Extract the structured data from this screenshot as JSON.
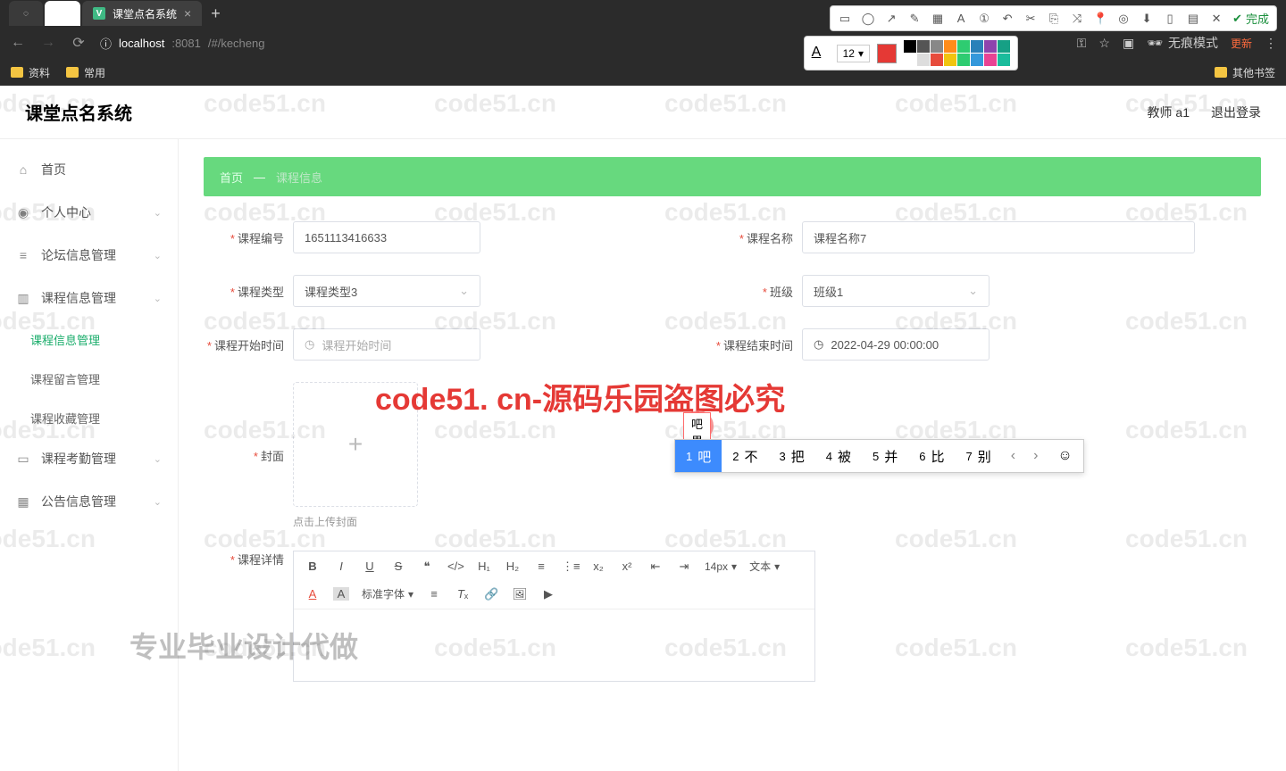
{
  "browser": {
    "tab_blank": "",
    "tab_title": "课堂点名系统",
    "url_host": "localhost",
    "url_port": ":8081",
    "url_path": "/#/kecheng",
    "bookmarks": [
      "资料",
      "常用"
    ],
    "other_bookmarks": "其他书签",
    "incognito": "无痕模式",
    "update": "更新"
  },
  "screenshot_tool": {
    "font_size": "12",
    "done": "完成",
    "colors_row1": [
      "#000000",
      "#555555",
      "#888888",
      "#ff8c1a",
      "#2ecc71",
      "#2980b9",
      "#8e44ad",
      "#16a085"
    ],
    "colors_row2": [
      "#ffffff",
      "#dddddd",
      "#e74c3c",
      "#f1c40f",
      "#2ecc71",
      "#3498db",
      "#e84393",
      "#1abc9c"
    ]
  },
  "header": {
    "app_title": "课堂点名系统",
    "user": "教师 a1",
    "logout": "退出登录"
  },
  "sidebar": {
    "home": "首页",
    "items": [
      {
        "label": "个人中心",
        "icon": "user"
      },
      {
        "label": "论坛信息管理",
        "icon": "list"
      },
      {
        "label": "课程信息管理",
        "icon": "book",
        "expanded": true,
        "children": [
          {
            "label": "课程信息管理",
            "active": true
          },
          {
            "label": "课程留言管理"
          },
          {
            "label": "课程收藏管理"
          }
        ]
      },
      {
        "label": "课程考勤管理",
        "icon": "briefcase"
      },
      {
        "label": "公告信息管理",
        "icon": "grid"
      }
    ]
  },
  "breadcrumb": {
    "home": "首页",
    "sep": "—",
    "current": "课程信息"
  },
  "form": {
    "course_no_label": "课程编号",
    "course_no": "1651113416633",
    "course_name_label": "课程名称",
    "course_name": "课程名称7",
    "course_type_label": "课程类型",
    "course_type": "课程类型3",
    "class_label": "班级",
    "class": "班级1",
    "start_label": "课程开始时间",
    "start_placeholder": "课程开始时间",
    "end_label": "课程结束时间",
    "end_value": "2022-04-29 00:00:00",
    "cover_label": "封面",
    "cover_hint": "点击上传封面",
    "detail_label": "课程详情"
  },
  "rte": {
    "size": "14px",
    "para": "文本",
    "font": "标准字体"
  },
  "ime": {
    "input": "吧果b",
    "candidates": [
      {
        "n": "1",
        "ch": "吧"
      },
      {
        "n": "2",
        "ch": "不"
      },
      {
        "n": "3",
        "ch": "把"
      },
      {
        "n": "4",
        "ch": "被"
      },
      {
        "n": "5",
        "ch": "并"
      },
      {
        "n": "6",
        "ch": "比"
      },
      {
        "n": "7",
        "ch": "别"
      }
    ]
  },
  "watermark": {
    "text": "code51.cn",
    "red": "code51. cn-源码乐园盗图必究",
    "gray": "专业毕业设计代做"
  }
}
